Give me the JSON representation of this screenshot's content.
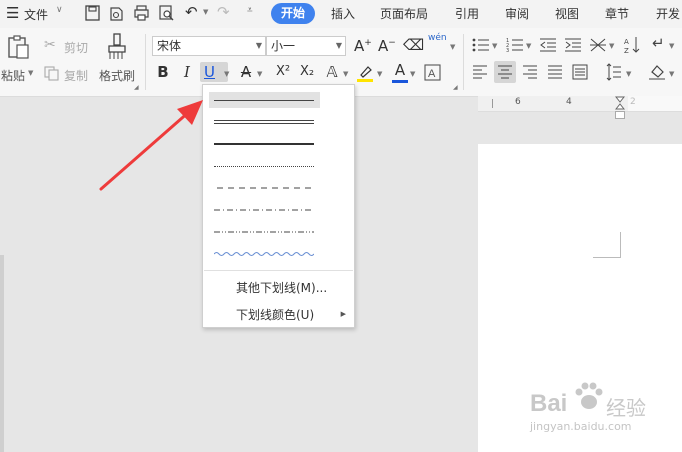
{
  "menubar": {
    "menu_label": "文件",
    "tabs": [
      "开始",
      "插入",
      "页面布局",
      "引用",
      "审阅",
      "视图",
      "章节",
      "开发"
    ],
    "active_tab": "开始",
    "accent_color": "#3f82ee"
  },
  "ribbon": {
    "paste_label": "粘贴",
    "cut_label": "剪切",
    "copy_label": "复制",
    "format_painter_label": "格式刷",
    "font_name": "宋体",
    "font_size": "小一",
    "bold_label": "B",
    "italic_label": "I",
    "underline_label": "U",
    "superscript_label": "X²",
    "subscript_label": "X₂",
    "font_color": "#1a56db",
    "highlight_color": "#ffe400"
  },
  "ruler": {
    "ticks": [
      "6",
      "4",
      "2",
      "2"
    ]
  },
  "underline_menu": {
    "styles": [
      "single",
      "double",
      "thick",
      "dotted",
      "dashed",
      "dash-dot",
      "dash-dot-dot",
      "wave"
    ],
    "selected_style": "single",
    "more_label": "其他下划线(M)...",
    "color_label": "下划线颜色(U)"
  },
  "watermark": {
    "brand": "Bai",
    "brand_suffix": "经验",
    "url": "jingyan.baidu.com"
  },
  "annotation": {
    "arrow_color": "#ee3b3b"
  }
}
